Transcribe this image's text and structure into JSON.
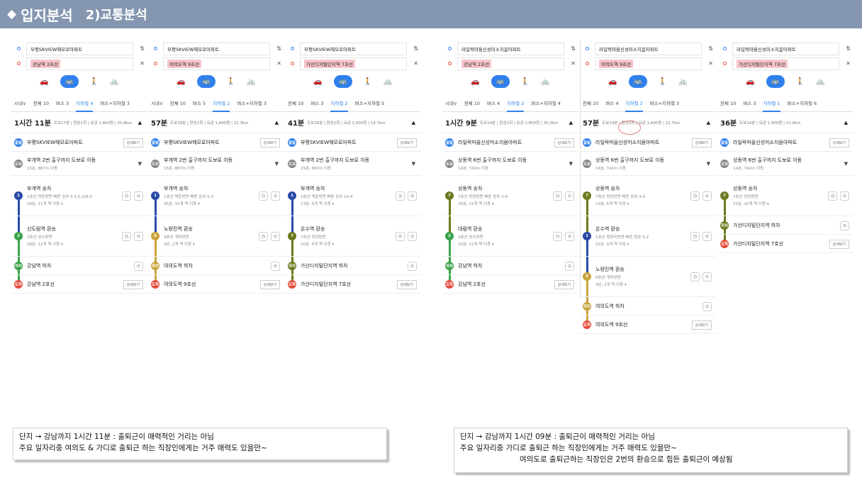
{
  "header": {
    "diamond": "◆",
    "title": "입지분석",
    "subtitle": "2)교통분석"
  },
  "panels": [
    {
      "origin": "부평SKVIEW해모로아파트",
      "dest": "강남역 2호선",
      "tabs": [
        "시내∨",
        "전체 10",
        "버스 3",
        "지하철 4",
        "버스+지하철 3"
      ],
      "active": 3,
      "time": "1시간 11분",
      "meta": "도보17분 | 환승1회 | 요금 1,800원 | 31.8km",
      "steps": [
        {
          "pin": "출발",
          "color": "#2f80ed",
          "name": "부평SKVIEW해모로아파트",
          "sub": "",
          "kind": "btn"
        },
        {
          "pin": "도보",
          "color": "#888",
          "name": "부개역 2번 출구까지 도보로 이동",
          "sub": "15분, 887m 이동",
          "kind": "chev"
        },
        {
          "pin": "1",
          "color": "#2a4aa8",
          "name": "부개역 승차",
          "sub": "1호선 역촌방면  빠른 승차 5-1,5-2/8-3",
          "sub2": "28분, 11개 역 이동 ▾",
          "kind": "ic2"
        },
        {
          "pin": "2",
          "color": "#3aa34a",
          "name": "신도림역 환승",
          "sub": "2호선 성수방면",
          "sub2": "28분, 12개 역 이동 ▾",
          "kind": "ic2"
        },
        {
          "pin": "하차",
          "color": "#3aa34a",
          "name": "강남역 하차",
          "sub": "",
          "kind": "ic1"
        },
        {
          "pin": "도착",
          "color": "#e74c3c",
          "name": "강남역 2호선",
          "sub": "",
          "kind": "btn"
        }
      ]
    },
    {
      "origin": "부평SKVIEW해모로아파트",
      "dest": "여의도역 9호선",
      "tabs": [
        "시내∨",
        "전체 10",
        "버스 5",
        "지하철 2",
        "버스+지하철 3"
      ],
      "active": 3,
      "time": "57분",
      "meta": "도보18분 | 환승1회 | 요금 1,600원 | 22.3km",
      "steps": [
        {
          "pin": "출발",
          "color": "#2f80ed",
          "name": "부평SKVIEW해모로아파트",
          "sub": "",
          "kind": "btn"
        },
        {
          "pin": "도보",
          "color": "#888",
          "name": "부개역 2번 출구까지 도보로 이동",
          "sub": "15분, 887m 이동",
          "kind": "chev"
        },
        {
          "pin": "1",
          "color": "#2a4aa8",
          "name": "부개역 승차",
          "sub": "1호선 역촌방면  빠른 승차 5-2",
          "sub2": "35분, 15개 역 이동 ▾",
          "kind": "ic2"
        },
        {
          "pin": "9",
          "color": "#c9a43a",
          "name": "노량진역 환승",
          "sub": "9호선 개화방면",
          "sub2": "4분, 2개 역 이동 ▾",
          "kind": "ic2"
        },
        {
          "pin": "하차",
          "color": "#c9a43a",
          "name": "여의도역 하차",
          "sub": "",
          "kind": "ic1"
        },
        {
          "pin": "도착",
          "color": "#e74c3c",
          "name": "여의도역 9호선",
          "sub": "",
          "kind": "btn"
        }
      ]
    },
    {
      "origin": "부평SKVIEW해모로아파트",
      "dest": "가산디지털단지역 7호선",
      "tabs": [
        "전체 10",
        "버스 3",
        "지하철 2",
        "버스+지하철 5"
      ],
      "active": 2,
      "time": "41분",
      "meta": "도보18분 | 환승1회 | 요금 1,500원 | 14.7km",
      "steps": [
        {
          "pin": "출발",
          "color": "#2f80ed",
          "name": "부평SKVIEW해모로아파트",
          "sub": "",
          "kind": "btn"
        },
        {
          "pin": "도보",
          "color": "#888",
          "name": "부개역 2번 출구까지 도보로 이동",
          "sub": "15분, 887m 이동",
          "kind": "chev"
        },
        {
          "pin": "1",
          "color": "#2a4aa8",
          "name": "부개역 승차",
          "sub": "1호선 역촌방면  빠른 승차 10-4",
          "sub2": "13분, 6개 역 이동 ▾",
          "kind": "ic2"
        },
        {
          "pin": "7",
          "color": "#6b7a1e",
          "name": "온수역 환승",
          "sub": "7호선 장암방면",
          "sub2": "10분, 4개 역 이동 ▾",
          "kind": "ic2"
        },
        {
          "pin": "하차",
          "color": "#6b7a1e",
          "name": "가산디지털단지역 하차",
          "sub": "",
          "kind": "ic1"
        },
        {
          "pin": "도착",
          "color": "#e74c3c",
          "name": "가산디지털단지역 7호선",
          "sub": "",
          "kind": "btn"
        }
      ]
    },
    {
      "origin": "라일락마을신성미소지움아파트",
      "dest": "강남역 2호선",
      "tabs": [
        "시내∨",
        "전체 10",
        "버스 4",
        "지하철 2",
        "버스+지하철 4"
      ],
      "active": 3,
      "time": "1시간 9분",
      "meta": "도보19분 | 환승1회 | 요금 1,800원 | 30.0km",
      "steps": [
        {
          "pin": "출발",
          "color": "#2f80ed",
          "name": "라일락마을신성미소지움아파트",
          "sub": "",
          "kind": "btn"
        },
        {
          "pin": "도보",
          "color": "#888",
          "name": "상동역 6번 출구까지 도보로 이동",
          "sub": "14분, 742m 이동",
          "kind": "chev"
        },
        {
          "pin": "7",
          "color": "#6b7a1e",
          "name": "상동역 승차",
          "sub": "7호선 장암방면  빠른 승차 3-4",
          "sub2": "26분, 12개 역 이동 ▾",
          "kind": "ic2"
        },
        {
          "pin": "2",
          "color": "#3aa34a",
          "name": "대림역 환승",
          "sub": "2호선 성수방면",
          "sub2": "25분, 11개 역 이동 ▾",
          "kind": "ic2"
        },
        {
          "pin": "하차",
          "color": "#3aa34a",
          "name": "강남역 하차",
          "sub": "",
          "kind": "ic1"
        },
        {
          "pin": "도착",
          "color": "#e74c3c",
          "name": "강남역 2호선",
          "sub": "",
          "kind": "btn"
        }
      ]
    },
    {
      "origin": "라일락마을신성미소지움아파트",
      "dest": "여의도역 9호선",
      "tabs": [
        "전체 10",
        "버스 4",
        "지하철 3",
        "버스+지하철 3"
      ],
      "active": 2,
      "time": "57분",
      "meta": "도보19분 | 환승2회 | 요금 1,600원 | 21.7km",
      "steps": [
        {
          "pin": "출발",
          "color": "#2f80ed",
          "name": "라일락마을신성미소지움아파트",
          "sub": "",
          "kind": "btn"
        },
        {
          "pin": "도보",
          "color": "#888",
          "name": "상동역 6번 출구까지 도보로 이동",
          "sub": "14분, 742m 이동",
          "kind": "chev"
        },
        {
          "pin": "7",
          "color": "#6b7a1e",
          "name": "상동역 승차",
          "sub": "7호선 장암방면  빠른 승차 3-4",
          "sub2": "12분, 6개 역 이동 ▾",
          "kind": "ic2"
        },
        {
          "pin": "1",
          "color": "#2a4aa8",
          "name": "온수역 환승",
          "sub": "1호선 청량리방면  빠른 환승 5-2",
          "sub2": "22분, 9개 역 이동 ▾",
          "kind": "ic2"
        },
        {
          "pin": "9",
          "color": "#c9a43a",
          "name": "노량진역 환승",
          "sub": "9호선 개화방면",
          "sub2": "4분, 2개 역 이동 ▾",
          "kind": "ic2"
        },
        {
          "pin": "하차",
          "color": "#c9a43a",
          "name": "여의도역 하차",
          "sub": "",
          "kind": "ic1"
        },
        {
          "pin": "도착",
          "color": "#e74c3c",
          "name": "여의도역 9호선",
          "sub": "",
          "kind": "btn"
        }
      ]
    },
    {
      "origin": "라일락마을신성미소지움아파트",
      "dest": "가산디지털단지역 7호선",
      "tabs": [
        "전체 10",
        "버스 3",
        "지하철 1",
        "버스+지하철 6"
      ],
      "active": 2,
      "time": "36분",
      "meta": "도보14분 | 요금 1,500원 | 13.9km",
      "steps": [
        {
          "pin": "출발",
          "color": "#2f80ed",
          "name": "라일락마을신성미소지움아파트",
          "sub": "",
          "kind": "btn"
        },
        {
          "pin": "도보",
          "color": "#888",
          "name": "상동역 6번 출구까지 도보로 이동",
          "sub": "14분, 742m 이동",
          "kind": "chev"
        },
        {
          "pin": "7",
          "color": "#6b7a1e",
          "name": "상동역 승차",
          "sub": "7호선 장암방면",
          "sub2": "22분, 10개 역 이동 ▾",
          "kind": "ic2"
        },
        {
          "pin": "하차",
          "color": "#6b7a1e",
          "name": "가산디지털단지역 하차",
          "sub": "",
          "kind": "ic1"
        },
        {
          "pin": "도착",
          "color": "#e74c3c",
          "name": "가산디지털단지역 7호선",
          "sub": "",
          "kind": "btn"
        }
      ]
    }
  ],
  "ui": {
    "detail": "상세보기",
    "swap": "⇅",
    "clear": "✕",
    "car": "🚗",
    "bus": "🚌",
    "walk": "🚶",
    "bike": "🚲",
    "collapse": "▲",
    "clock": "◷",
    "pinicon": "⊙"
  },
  "notes": {
    "left": [
      "단지 → 강남까지  1시간 11분  :  출퇴근이 매력적인 거리는 아님",
      "주요 일자리중 여의도 & 가디로 출퇴근 하는 직장인에게는 거주 매력도 있을만~"
    ],
    "right": [
      "단지 → 강남까지  1시간 09분  :  출퇴근이 매력적인 거리는 아님",
      "주요 일자리중 가디로 출퇴근 하는 직장인에게는 거주 매력도 있을만~",
      "여의도로 출퇴근하는 직장인은 2번의 환승으로 힘든 출퇴근이 예상됨"
    ]
  }
}
